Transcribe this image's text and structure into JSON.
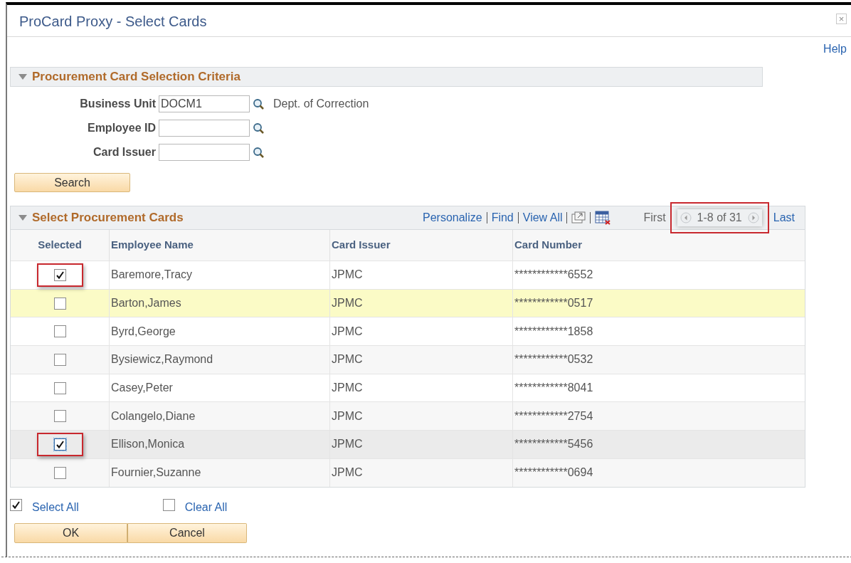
{
  "window": {
    "title": "ProCard Proxy - Select Cards",
    "close": "×",
    "help": "Help"
  },
  "criteria": {
    "title": "Procurement Card Selection Criteria",
    "expanded": true,
    "fields": [
      {
        "label": "Business Unit",
        "value": "DOCM1",
        "description": "Dept. of Correction"
      },
      {
        "label": "Employee ID"
      },
      {
        "label": "Card Issuer"
      }
    ],
    "search_button": "Search"
  },
  "grid": {
    "title": "Select Procurement Cards",
    "expanded": true,
    "links": [
      "Personalize",
      "Find",
      "View All"
    ],
    "pager": {
      "first": "First",
      "range": "1-8 of 31",
      "last": "Last",
      "annotated": true
    },
    "columns": [
      "Selected",
      "Employee Name",
      "Card Issuer",
      "Card Number"
    ],
    "rows": [
      {
        "checked": true,
        "annotated": true,
        "highlighted": false,
        "focused": false,
        "name": "Baremore,Tracy",
        "issuer": "JPMC",
        "card": "************6552"
      },
      {
        "checked": false,
        "annotated": false,
        "highlighted": true,
        "focused": false,
        "name": "Barton,James",
        "issuer": "JPMC",
        "card": "************0517"
      },
      {
        "checked": false,
        "annotated": false,
        "highlighted": false,
        "focused": false,
        "name": "Byrd,George",
        "issuer": "JPMC",
        "card": "************1858"
      },
      {
        "checked": false,
        "annotated": false,
        "highlighted": false,
        "focused": false,
        "name": "Bysiewicz,Raymond",
        "issuer": "JPMC",
        "card": "************0532"
      },
      {
        "checked": false,
        "annotated": false,
        "highlighted": false,
        "focused": false,
        "name": "Casey,Peter",
        "issuer": "JPMC",
        "card": "************8041"
      },
      {
        "checked": false,
        "annotated": false,
        "highlighted": false,
        "focused": false,
        "name": "Colangelo,Diane",
        "issuer": "JPMC",
        "card": "************2754"
      },
      {
        "checked": true,
        "annotated": true,
        "highlighted": false,
        "focused": true,
        "name": "Ellison,Monica",
        "issuer": "JPMC",
        "card": "************5456"
      },
      {
        "checked": false,
        "annotated": false,
        "highlighted": false,
        "focused": false,
        "name": "Fournier,Suzanne",
        "issuer": "JPMC",
        "card": "************0694"
      }
    ]
  },
  "select_all": "Select All",
  "clear_all": "Clear All",
  "buttons": [
    "OK",
    "Cancel"
  ]
}
